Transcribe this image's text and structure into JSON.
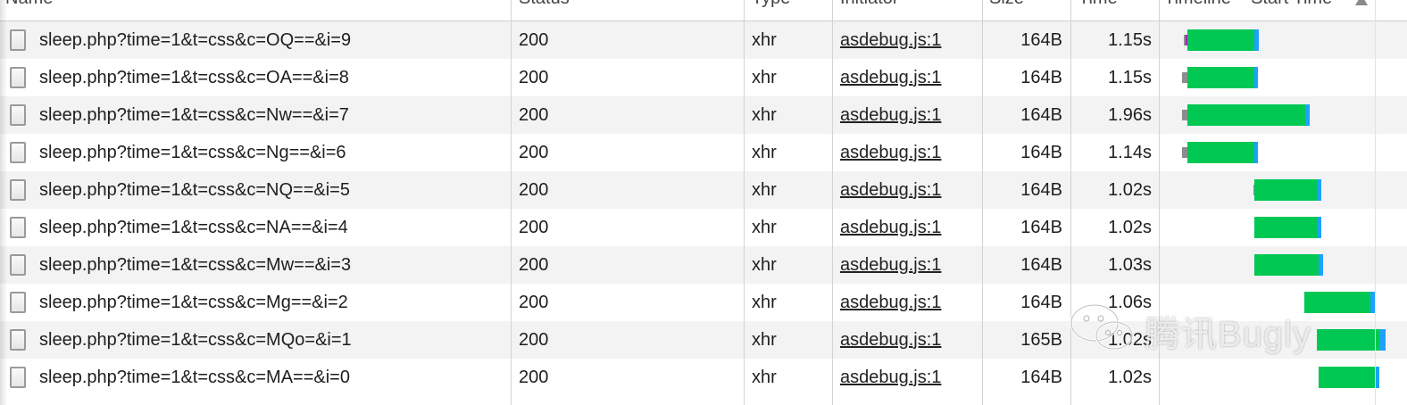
{
  "columns": {
    "name": "Name",
    "status": "Status",
    "type": "Type",
    "initiator": "Initiator",
    "size": "Size",
    "time": "Time",
    "timeline": "Timeline – Start Time"
  },
  "colors": {
    "waiting": "#00c853",
    "receiving": "#1ea1ff",
    "queued": "#8c8c8c",
    "row_alt": "#f3f3f3"
  },
  "rows": [
    {
      "name": "sleep.php?time=1&t=css&c=OQ==&i=9",
      "status": "200",
      "type": "xhr",
      "initiator": "asdebug.js:1",
      "size": "164B",
      "time": "1.15s",
      "timeline": {
        "queued_start": 1326,
        "start": 1330,
        "wait_end": 1405,
        "end": 1410
      }
    },
    {
      "name": "sleep.php?time=1&t=css&c=OA==&i=8",
      "status": "200",
      "type": "xhr",
      "initiator": "asdebug.js:1",
      "size": "164B",
      "time": "1.15s",
      "timeline": {
        "queued_start": 1324,
        "start": 1330,
        "wait_end": 1405,
        "end": 1409
      }
    },
    {
      "name": "sleep.php?time=1&t=css&c=Nw==&i=7",
      "status": "200",
      "type": "xhr",
      "initiator": "asdebug.js:1",
      "size": "164B",
      "time": "1.96s",
      "timeline": {
        "queued_start": 1324,
        "start": 1330,
        "wait_end": 1462,
        "end": 1467
      }
    },
    {
      "name": "sleep.php?time=1&t=css&c=Ng==&i=6",
      "status": "200",
      "type": "xhr",
      "initiator": "asdebug.js:1",
      "size": "164B",
      "time": "1.14s",
      "timeline": {
        "queued_start": 1324,
        "start": 1330,
        "wait_end": 1405,
        "end": 1409
      }
    },
    {
      "name": "sleep.php?time=1&t=css&c=NQ==&i=5",
      "status": "200",
      "type": "xhr",
      "initiator": "asdebug.js:1",
      "size": "164B",
      "time": "1.02s",
      "timeline": {
        "queued_start": 1404,
        "start": 1405,
        "wait_end": 1476,
        "end": 1480
      }
    },
    {
      "name": "sleep.php?time=1&t=css&c=NA==&i=4",
      "status": "200",
      "type": "xhr",
      "initiator": "asdebug.js:1",
      "size": "164B",
      "time": "1.02s",
      "timeline": {
        "queued_start": 1405,
        "start": 1405,
        "wait_end": 1476,
        "end": 1480
      }
    },
    {
      "name": "sleep.php?time=1&t=css&c=Mw==&i=3",
      "status": "200",
      "type": "xhr",
      "initiator": "asdebug.js:1",
      "size": "164B",
      "time": "1.03s",
      "timeline": {
        "queued_start": 1405,
        "start": 1405,
        "wait_end": 1477,
        "end": 1482
      }
    },
    {
      "name": "sleep.php?time=1&t=css&c=Mg==&i=2",
      "status": "200",
      "type": "xhr",
      "initiator": "asdebug.js:1",
      "size": "164B",
      "time": "1.06s",
      "timeline": {
        "queued_start": 1461,
        "start": 1461,
        "wait_end": 1535,
        "end": 1540
      }
    },
    {
      "name": "sleep.php?time=1&t=css&c=MQo=&i=1",
      "status": "200",
      "type": "xhr",
      "initiator": "asdebug.js:1",
      "size": "165B",
      "time": "1.02s",
      "timeline": {
        "queued_start": 1475,
        "start": 1475,
        "wait_end": 1545,
        "end": 1552
      }
    },
    {
      "name": "sleep.php?time=1&t=css&c=MA==&i=0",
      "status": "200",
      "type": "xhr",
      "initiator": "asdebug.js:1",
      "size": "164B",
      "time": "1.02s",
      "timeline": {
        "queued_start": 1477,
        "start": 1477,
        "wait_end": 1540,
        "end": 1545
      }
    }
  ],
  "watermark": {
    "text": "腾讯Bugly",
    "icon": "wechat-icon"
  }
}
